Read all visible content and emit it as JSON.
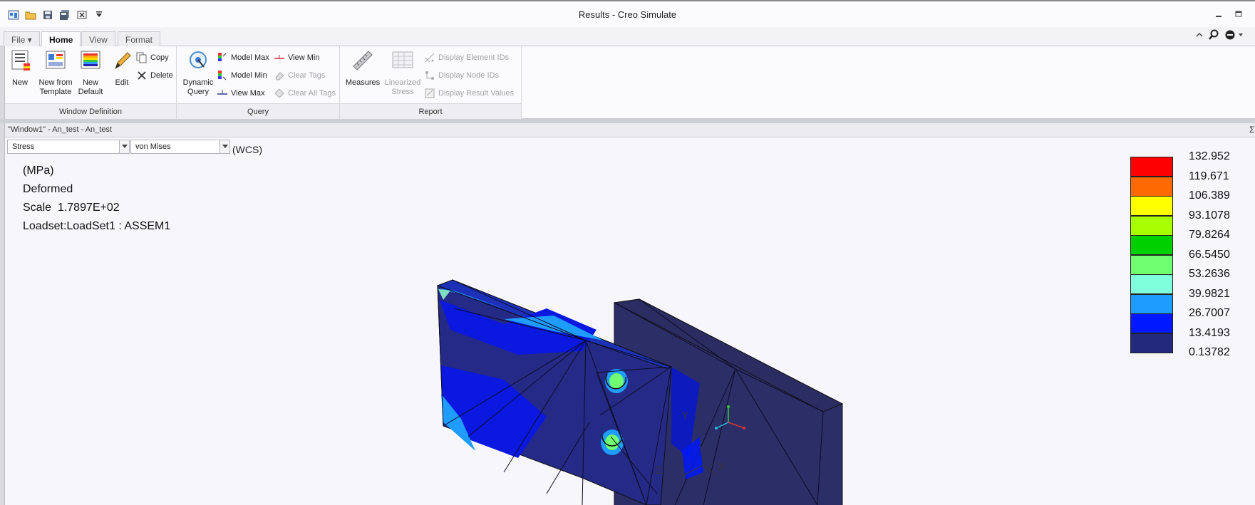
{
  "titlebar": {
    "title": "Results - Creo Simulate"
  },
  "quick_access": {
    "icons": [
      "window-icon",
      "open-icon",
      "save-icon",
      "save-copy-icon",
      "close-window-icon",
      "customize-icon"
    ]
  },
  "tabs": [
    {
      "label": "File ▾"
    },
    {
      "label": "Home"
    },
    {
      "label": "View"
    },
    {
      "label": "Format"
    }
  ],
  "ribbon": {
    "window_definition": {
      "label": "Window Definition",
      "new": "New",
      "new_from_template_1": "New from",
      "new_from_template_2": "Template",
      "new_default_1": "New",
      "new_default_2": "Default",
      "edit": "Edit",
      "copy": "Copy",
      "delete": "Delete"
    },
    "query": {
      "label": "Query",
      "dynamic_query_1": "Dynamic",
      "dynamic_query_2": "Query",
      "model_max": "Model Max",
      "model_min": "Model Min",
      "view_max": "View Max",
      "view_min": "View Min",
      "clear_tags": "Clear Tags",
      "clear_all_tags": "Clear All Tags"
    },
    "report": {
      "label": "Report",
      "measures": "Measures",
      "linearized_1": "Linearized",
      "linearized_2": "Stress",
      "display_element_ids": "Display Element IDs",
      "display_node_ids": "Display Node IDs",
      "display_result_values": "Display Result Values"
    }
  },
  "window": {
    "title": "\"Window1\" - An_test - An_test",
    "quantity": "Stress",
    "component": "von Mises",
    "coord_sys": "(WCS)",
    "units": "(MPa)",
    "mode": "Deformed",
    "scale_label": "Scale",
    "scale_value": "1.7897E+02",
    "loadset": "Loadset:LoadSet1 :  ASSEM1"
  },
  "legend": {
    "values": [
      "132.952",
      "119.671",
      "106.389",
      "93.1078",
      "79.8264",
      "66.5450",
      "53.2636",
      "39.9821",
      "26.7007",
      "13.4193",
      "0.13782"
    ],
    "colors": [
      "#ff0000",
      "#ff6a00",
      "#ffff00",
      "#a8ff00",
      "#00d000",
      "#70ff70",
      "#80ffdd",
      "#1e9cff",
      "#0018ff",
      "#232a7e"
    ]
  },
  "triad": {
    "y": "Y",
    "x": "X",
    "z": "Z"
  }
}
